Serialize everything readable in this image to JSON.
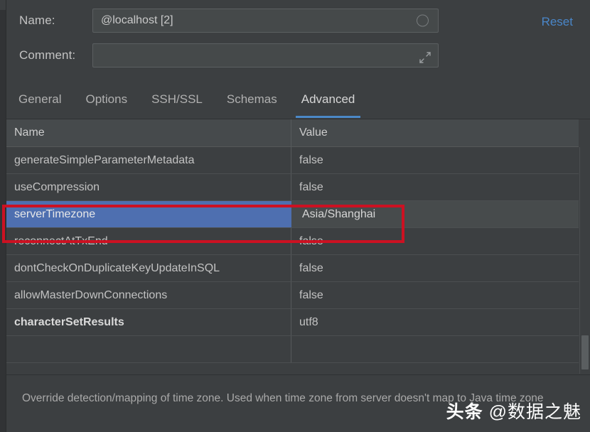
{
  "form": {
    "name_label": "Name:",
    "name_value": "@localhost [2]",
    "name_icon": "circle-icon",
    "comment_label": "Comment:",
    "comment_value": "",
    "comment_placeholder": "",
    "comment_icon": "expand-icon",
    "reset_label": "Reset"
  },
  "tabs": {
    "items": [
      {
        "label": "General",
        "active": false
      },
      {
        "label": "Options",
        "active": false
      },
      {
        "label": "SSH/SSL",
        "active": false
      },
      {
        "label": "Schemas",
        "active": false
      },
      {
        "label": "Advanced",
        "active": true
      }
    ]
  },
  "table": {
    "headers": {
      "name": "Name",
      "value": "Value"
    },
    "rows": [
      {
        "name": "generateSimpleParameterMetadata",
        "value": "false",
        "selected": false,
        "modified": false
      },
      {
        "name": "useCompression",
        "value": "false",
        "selected": false,
        "modified": false
      },
      {
        "name": "serverTimezone",
        "value": "Asia/Shanghai",
        "selected": true,
        "modified": false
      },
      {
        "name": "reconnectAtTxEnd",
        "value": "false",
        "selected": false,
        "modified": false
      },
      {
        "name": "dontCheckOnDuplicateKeyUpdateInSQL",
        "value": "false",
        "selected": false,
        "modified": false
      },
      {
        "name": "allowMasterDownConnections",
        "value": "false",
        "selected": false,
        "modified": false
      },
      {
        "name": "characterSetResults",
        "value": "utf8",
        "selected": false,
        "modified": true
      },
      {
        "name": "",
        "value": "",
        "selected": false,
        "modified": false
      }
    ]
  },
  "description": {
    "text": "Override detection/mapping of time zone. Used when time zone from server doesn't map to Java time zone"
  },
  "annotation": {
    "color": "#cc1122",
    "target_row": "serverTimezone"
  },
  "watermark": {
    "brand": "头条",
    "handle": "@数据之魅"
  },
  "colors": {
    "background": "#3c3f41",
    "selection": "#4e6fb0",
    "accent": "#4a88c7",
    "link": "#4a86c8",
    "annotation": "#cc1122"
  }
}
